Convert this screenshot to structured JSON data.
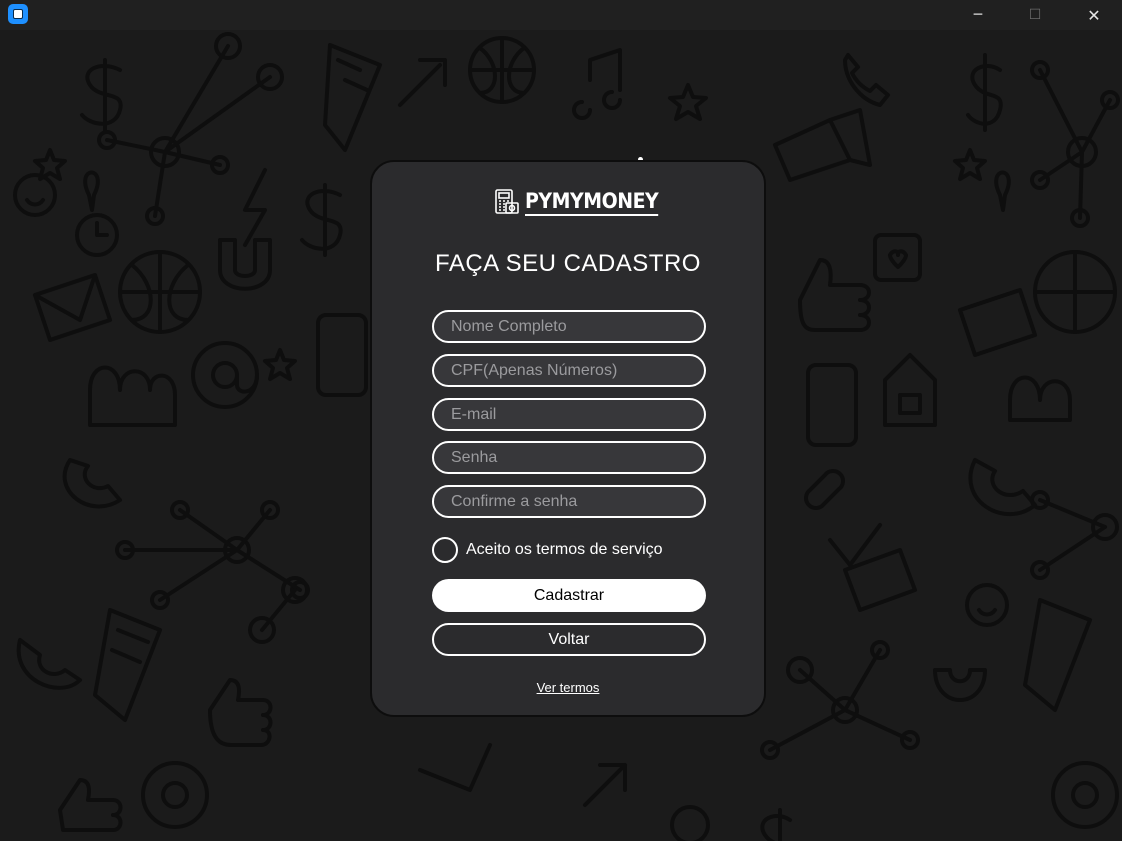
{
  "window": {
    "app_icon": "app-square-icon",
    "controls": {
      "minimize": "─",
      "maximize": "☐",
      "close": "✕"
    }
  },
  "background": {
    "pattern": "doodle-icons",
    "color": "#1b1b1b",
    "stroke_color": "#0e0e0e"
  },
  "form": {
    "logo_text": "PYMYMONEY",
    "logo_icon": "calculator-money-icon",
    "title": "FAÇA SEU CADASTRO",
    "fields": {
      "full_name_placeholder": "Nome Completo",
      "cpf_placeholder": "CPF(Apenas Números)",
      "email_placeholder": "E-mail",
      "password_placeholder": "Senha",
      "confirm_password_placeholder": "Confirme a senha"
    },
    "terms_checkbox_label": "Aceito os termos de serviço",
    "terms_checked": false,
    "register_button": "Cadastrar",
    "back_button": "Voltar",
    "view_terms_link": "Ver termos"
  },
  "colors": {
    "card": "#2b2b2d",
    "field_bg": "#37373a",
    "accent": "#ffffff"
  }
}
